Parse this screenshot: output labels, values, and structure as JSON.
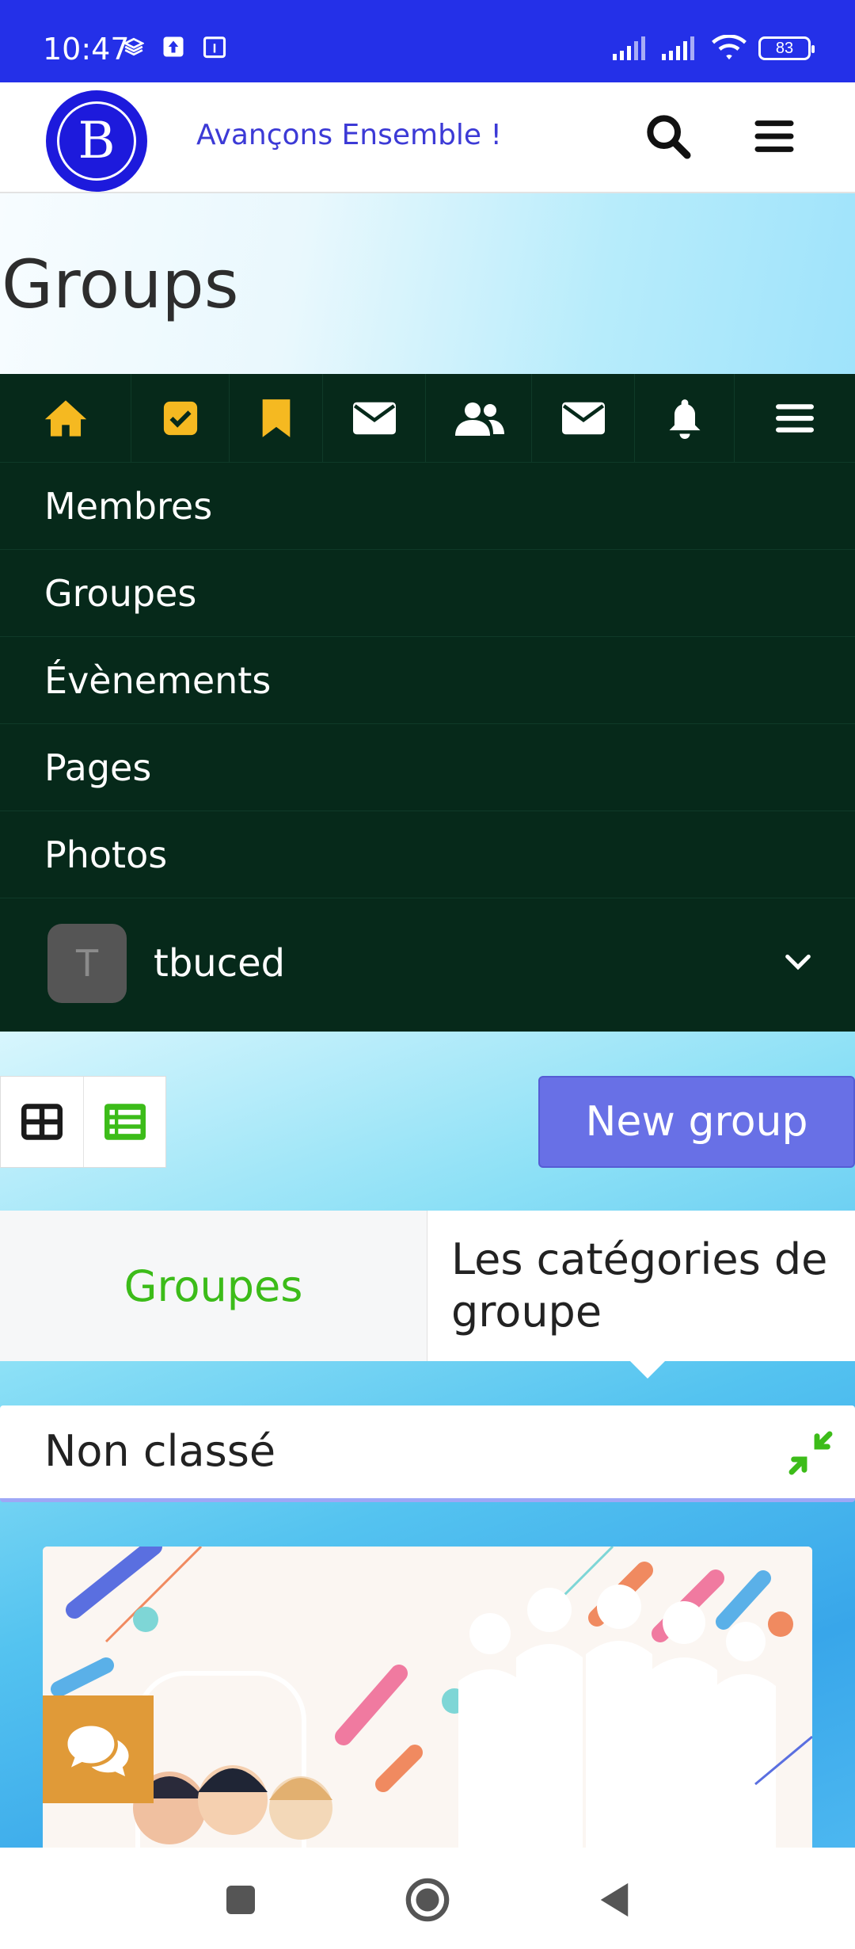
{
  "status_bar": {
    "time": "10:47",
    "battery": "83",
    "icons": [
      "layers-icon",
      "upload-icon",
      "calendar-icon",
      "signal-icon",
      "signal-icon",
      "wifi-icon",
      "battery-icon"
    ]
  },
  "header": {
    "logo_letter": "B",
    "tagline": "Avançons Ensemble !",
    "search_icon": "search-icon",
    "menu_icon": "hamburger-icon"
  },
  "page": {
    "title": "Groups"
  },
  "nav": {
    "icons": [
      {
        "name": "home-icon",
        "color": "#f5b921"
      },
      {
        "name": "check-square-icon",
        "color": "#f5b921"
      },
      {
        "name": "bookmark-icon",
        "color": "#f5b921"
      },
      {
        "name": "envelope-icon",
        "color": "#ffffff"
      },
      {
        "name": "users-icon",
        "color": "#ffffff"
      },
      {
        "name": "envelope-icon",
        "color": "#ffffff"
      },
      {
        "name": "bell-icon",
        "color": "#ffffff"
      },
      {
        "name": "hamburger-icon",
        "color": "#ffffff"
      }
    ],
    "menu_items": [
      "Membres",
      "Groupes",
      "Évènements",
      "Pages",
      "Photos"
    ],
    "user": {
      "avatar_letter": "T",
      "name": "tbuced"
    }
  },
  "content": {
    "new_group_label": "New group",
    "tabs": {
      "groups_label": "Groupes",
      "categories_label": "Les catégories de groupe"
    },
    "section_title": "Non classé"
  },
  "colors": {
    "status_bar": "#2430e8",
    "nav_bg": "#06291a",
    "accent_yellow": "#f5b921",
    "accent_green": "#3cbc19",
    "button_purple": "#6870e6",
    "tagline": "#3c3ad6",
    "chat_badge": "#e09a38"
  }
}
